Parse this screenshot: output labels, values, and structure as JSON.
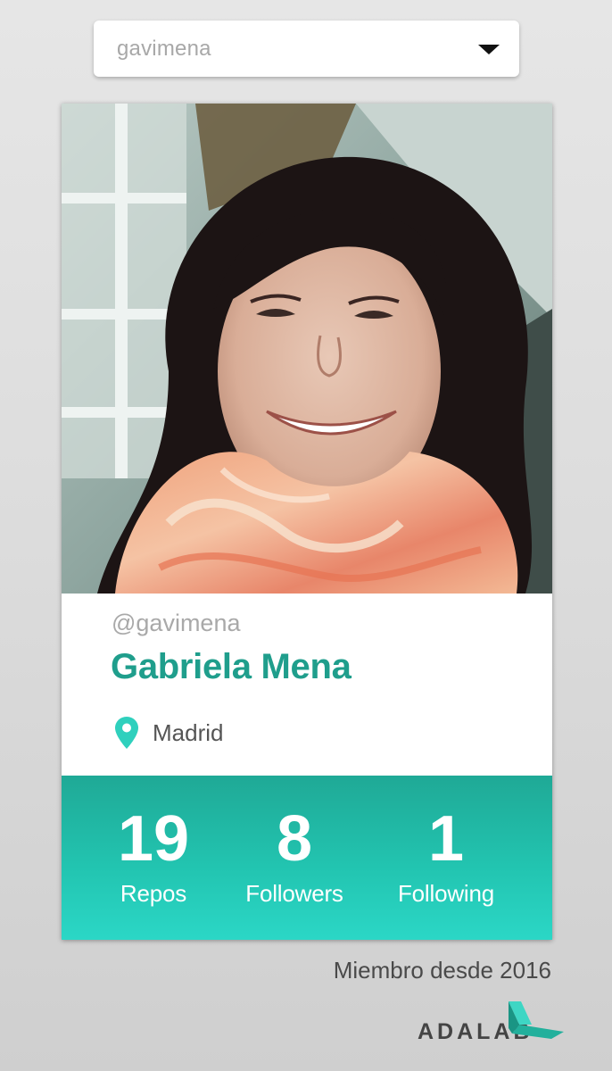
{
  "user_select": {
    "selected": "gavimena"
  },
  "profile": {
    "username": "@gavimena",
    "name": "Gabriela Mena",
    "location": "Madrid",
    "stats": [
      {
        "value": "19",
        "label": "Repos"
      },
      {
        "value": "8",
        "label": "Followers"
      },
      {
        "value": "1",
        "label": "Following"
      }
    ]
  },
  "footer": {
    "member_since": "Miembro desde 2016",
    "logo_text": "ADALAB"
  },
  "colors": {
    "accent": "#1f9e8c",
    "stats_gradient_top": "#1fa996",
    "stats_gradient_bottom": "#2bd7c6",
    "pin": "#2fd0bd"
  },
  "icons": {
    "dropdown": "chevron-down-icon",
    "location": "map-pin-icon"
  }
}
